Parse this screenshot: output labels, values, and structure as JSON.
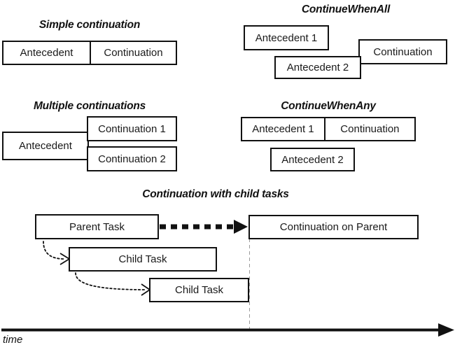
{
  "diagram": {
    "title_time_axis": "time",
    "sections": [
      {
        "id": "simple-continuation",
        "title": "Simple continuation",
        "boxes": [
          {
            "label": "Antecedent"
          },
          {
            "label": "Continuation"
          }
        ]
      },
      {
        "id": "continue-when-all",
        "title": "ContinueWhenAll",
        "boxes": [
          {
            "label": "Antecedent 1"
          },
          {
            "label": "Antecedent 2"
          },
          {
            "label": "Continuation"
          }
        ]
      },
      {
        "id": "multiple-continuations",
        "title": "Multiple continuations",
        "boxes": [
          {
            "label": "Antecedent"
          },
          {
            "label": "Continuation 1"
          },
          {
            "label": "Continuation 2"
          }
        ]
      },
      {
        "id": "continue-when-any",
        "title": "ContinueWhenAny",
        "boxes": [
          {
            "label": "Antecedent 1"
          },
          {
            "label": "Continuation"
          },
          {
            "label": "Antecedent 2"
          }
        ]
      },
      {
        "id": "continuation-with-child-tasks",
        "title": "Continuation with child tasks",
        "boxes": [
          {
            "label": "Parent Task"
          },
          {
            "label": "Continuation on Parent"
          },
          {
            "label": "Child Task"
          },
          {
            "label": "Child Task"
          }
        ]
      }
    ]
  },
  "colors": {
    "stroke": "#111111",
    "background": "#ffffff",
    "text": "#1a1a1a",
    "guide": "#9a9a9a"
  }
}
